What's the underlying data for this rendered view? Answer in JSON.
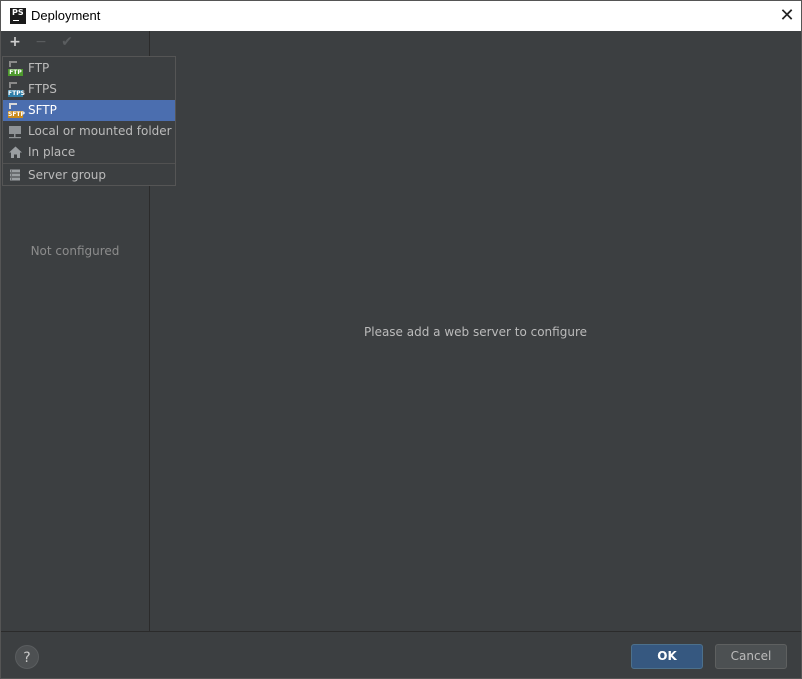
{
  "window": {
    "title": "Deployment",
    "close_glyph": "✕"
  },
  "toolbar": {
    "add_glyph": "+",
    "remove_glyph": "−",
    "apply_glyph": "✔"
  },
  "left_panel": {
    "empty_text": "Not configured"
  },
  "main": {
    "empty_text": "Please add a web server to configure"
  },
  "popup": {
    "items": [
      {
        "label": "FTP",
        "icon": "ftp-icon",
        "tag": "FTP",
        "color": "#4e9a2e"
      },
      {
        "label": "FTPS",
        "icon": "ftps-icon",
        "tag": "FTPS",
        "color": "#2e7fa8"
      },
      {
        "label": "SFTP",
        "icon": "sftp-icon",
        "tag": "SFTP",
        "color": "#c98a1b",
        "selected": true
      },
      {
        "label": "Local or mounted folder",
        "icon": "folder-icon"
      },
      {
        "label": "In place",
        "icon": "home-icon"
      },
      {
        "label": "Server group",
        "icon": "server-group-icon"
      }
    ]
  },
  "footer": {
    "help_glyph": "?",
    "ok_label": "OK",
    "cancel_label": "Cancel"
  },
  "colors": {
    "background": "#3c3f41",
    "selection": "#4b6eaf",
    "ok_button": "#365880"
  }
}
